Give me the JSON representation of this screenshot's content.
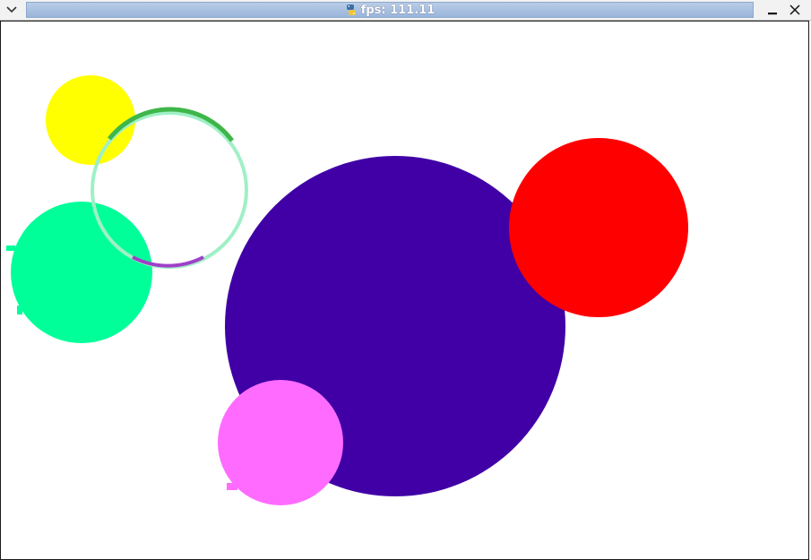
{
  "window": {
    "title": "fps: 111.11"
  },
  "icons": {
    "menu": "chevron-down-icon",
    "app": "python-logo-icon",
    "minimize": "minimize-icon",
    "close": "close-icon"
  },
  "colors": {
    "title_bar": "#9ab5dc",
    "canvas_background": "#ffffff",
    "yellow_ball": "#ffff00",
    "green_ball": "#00ff99",
    "indigo_ball": "#4000a6",
    "red_ball": "#ff0000",
    "pink_ball": "#ff6bff",
    "ring_light": "#9ff0c6",
    "ring_dark_green": "#3fb64a",
    "ring_purple": "#a040c8"
  }
}
